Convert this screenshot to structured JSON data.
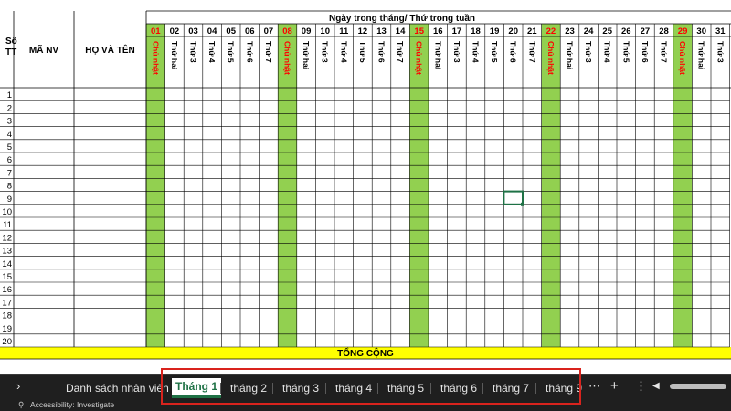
{
  "sheet": {
    "header_top": "Ngày trong tháng/ Thứ trong tuần",
    "col_stt": "Số TT",
    "col_ma_nv": "MÃ NV",
    "col_ho_ten": "HỌ VÀ TÊN",
    "total_label": "TỔNG CỘNG",
    "days": [
      "01",
      "02",
      "03",
      "04",
      "05",
      "06",
      "07",
      "08",
      "09",
      "10",
      "11",
      "12",
      "13",
      "14",
      "15",
      "16",
      "17",
      "18",
      "19",
      "20",
      "21",
      "22",
      "23",
      "24",
      "25",
      "26",
      "27",
      "28",
      "29",
      "30",
      "31"
    ],
    "weekdays": [
      "Chủ nhật",
      "Thứ hai",
      "Thứ 3",
      "Thứ 4",
      "Thứ 5",
      "Thứ 6",
      "Thứ 7",
      "Chủ nhật",
      "Thứ hai",
      "Thứ 3",
      "Thứ 4",
      "Thứ 5",
      "Thứ 6",
      "Thứ 7",
      "Chủ nhật",
      "Thứ hai",
      "Thứ 3",
      "Thứ 4",
      "Thứ 5",
      "Thứ 6",
      "Thứ 7",
      "Chủ nhật",
      "Thứ hai",
      "Thứ 3",
      "Thứ 4",
      "Thứ 5",
      "Thứ 6",
      "Thứ 7",
      "Chủ nhật",
      "Thứ hai",
      "Thứ 3"
    ],
    "sunday_days": [
      "01",
      "08",
      "15",
      "22",
      "29"
    ],
    "row_numbers": [
      "1",
      "2",
      "3",
      "4",
      "5",
      "6",
      "7",
      "8",
      "9",
      "10",
      "11",
      "12",
      "13",
      "14",
      "15",
      "16",
      "17",
      "18",
      "19",
      "20"
    ],
    "colors": {
      "sunday_fill": "#92d050",
      "sunday_text": "#ff0000",
      "total_fill": "#ffff00",
      "selection": "#1e7145",
      "highlight_box": "#d9231d"
    }
  },
  "tabs": {
    "first": "Danh sách nhân viên",
    "items": [
      "Tháng 1",
      "tháng 2",
      "tháng 3",
      "tháng 4",
      "tháng 5",
      "tháng 6",
      "tháng 7",
      "tháng 9"
    ],
    "active": "Tháng 1"
  },
  "status": {
    "accessibility": "Accessibility: Investigate"
  },
  "icons": {
    "nav_next": "chevron-right-icon",
    "more": "more-icon",
    "add": "add-sheet-icon",
    "menu": "vertical-dots-icon",
    "scroll_left": "scroll-left-icon"
  }
}
